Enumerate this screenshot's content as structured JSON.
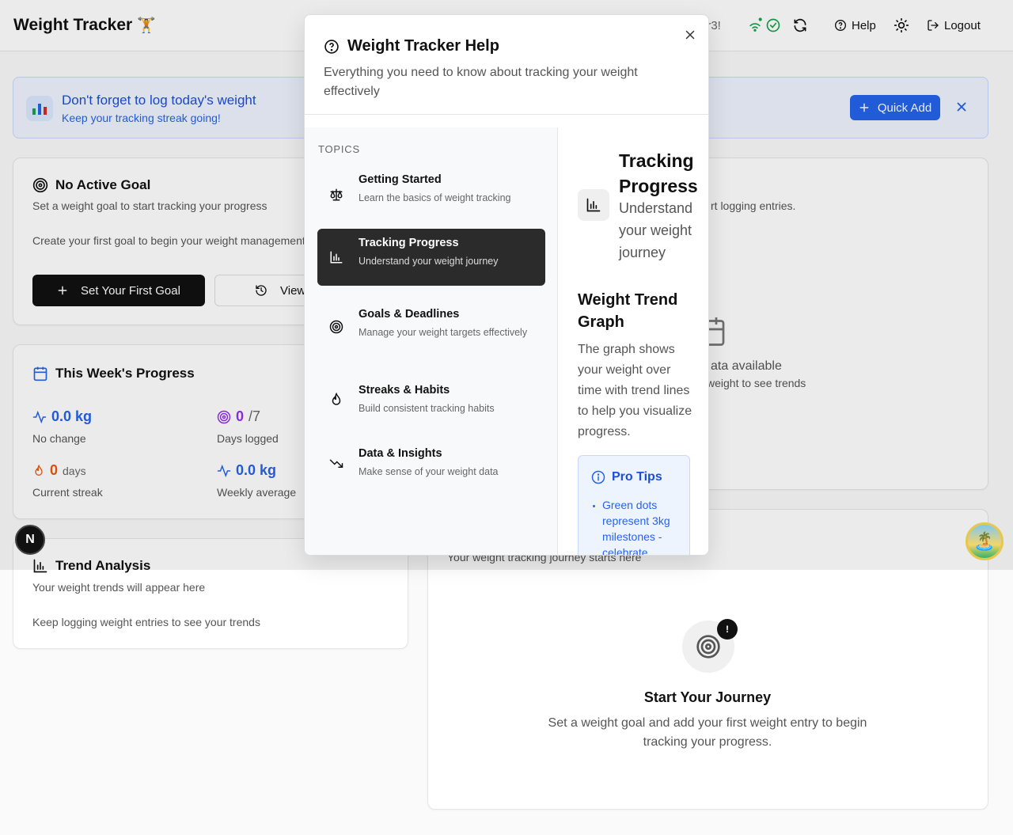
{
  "header": {
    "app_title": "Weight Tracker",
    "app_emoji": "🏋️",
    "user_text": "er3!",
    "help_label": "Help",
    "logout_label": "Logout"
  },
  "banner": {
    "title": "Don't forget to log today's weight",
    "subtitle": "Keep your tracking streak going!",
    "quick_add_label": "Quick Add"
  },
  "goal_card": {
    "title": "No Active Goal",
    "subtitle": "Set a weight goal to start tracking your progress",
    "body": "Create your first goal to begin your weight management",
    "primary_button": "Set Your First Goal",
    "secondary_button": "View"
  },
  "chart_card": {
    "subtitle": "rt logging entries.",
    "empty_title": "ata available",
    "empty_desc": "weight to see trends"
  },
  "week_card": {
    "title": "This Week's Progress",
    "stats": [
      {
        "value": "0.0 kg",
        "label": "No change"
      },
      {
        "value": "0",
        "suffix": "/7",
        "label": "Days logged"
      },
      {
        "value": "0",
        "suffix": "days",
        "label": "Current streak"
      },
      {
        "value": "0.0 kg",
        "label": "Weekly average"
      }
    ]
  },
  "trend_card": {
    "title": "Trend Analysis",
    "subtitle": "Your weight trends will appear here",
    "body": "Keep logging weight entries to see your trends"
  },
  "journey_card": {
    "subtitle": "Your weight tracking journey starts here",
    "badge": "!",
    "empty_title": "Start Your Journey",
    "empty_desc": "Set a weight goal and add your first weight entry to begin tracking your progress."
  },
  "dev_badge": "N",
  "modal": {
    "title": "Weight Tracker Help",
    "subtitle": "Everything you need to know about tracking your weight effectively",
    "topics_heading": "TOPICS",
    "topics": [
      {
        "title": "Getting Started",
        "desc": "Learn the basics of weight tracking",
        "icon": "scale-icon"
      },
      {
        "title": "Tracking Progress",
        "desc": "Understand your weight journey",
        "icon": "bar-chart-icon",
        "active": true
      },
      {
        "title": "Goals & Deadlines",
        "desc": "Manage your weight targets effectively",
        "icon": "target-icon"
      },
      {
        "title": "Streaks & Habits",
        "desc": "Build consistent tracking habits",
        "icon": "flame-icon"
      },
      {
        "title": "Data & Insights",
        "desc": "Make sense of your weight data",
        "icon": "trending-down-icon"
      }
    ],
    "detail": {
      "title": "Tracking Progress",
      "subtitle": "Understand your weight journey",
      "section_heading": "Weight Trend Graph",
      "section_text": "The graph shows your weight over time with trend lines to help you visualize progress.",
      "tips_title": "Pro Tips",
      "tips": [
        "Green dots represent 3kg milestones - celebrate"
      ]
    }
  },
  "colors": {
    "accent": "#2563eb",
    "purple": "#9333ea",
    "orange": "#ea580c",
    "online": "#16a34a"
  }
}
